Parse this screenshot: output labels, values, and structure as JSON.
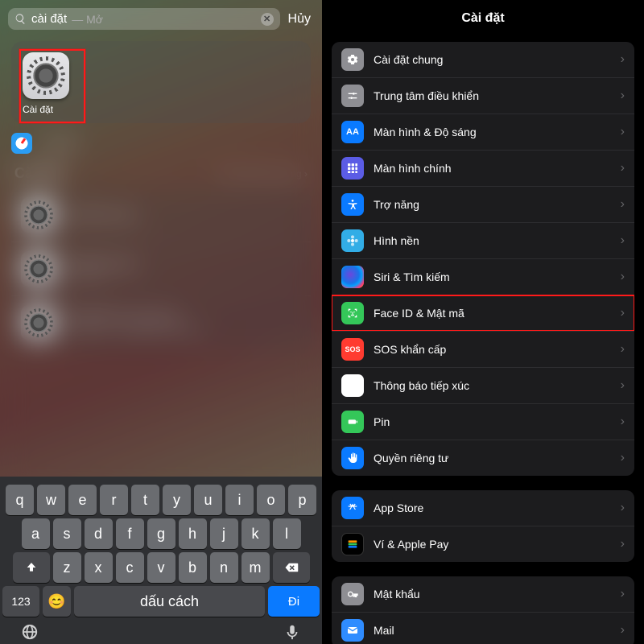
{
  "left": {
    "search": {
      "query": "cài đặt",
      "hint": "— Mở",
      "cancel": "Hủy"
    },
    "top_app": {
      "label": "Cài đặt"
    },
    "suggestion": {
      "text": "cài đặt"
    },
    "section": {
      "title": "Cài đặt",
      "link": "Tìm trong ứng dụng"
    },
    "results": [
      {
        "title": "Cài đặt chung",
        "sub": ""
      },
      {
        "title": "Cài đặt chung",
        "sub": "Trợ năng"
      },
      {
        "title": "Cài đặt theo ứng dụng",
        "sub": "Trợ năng → Cài đặt theo ứng dụng"
      }
    ],
    "keyboard": {
      "r1": [
        "q",
        "w",
        "e",
        "r",
        "t",
        "y",
        "u",
        "i",
        "o",
        "p"
      ],
      "r2": [
        "a",
        "s",
        "d",
        "f",
        "g",
        "h",
        "j",
        "k",
        "l"
      ],
      "r3": [
        "z",
        "x",
        "c",
        "v",
        "b",
        "n",
        "m"
      ],
      "switch": "123",
      "space": "dấu cách",
      "go": "Đi"
    }
  },
  "right": {
    "title": "Cài đặt",
    "g1": [
      {
        "icon": "gear",
        "bg": "bg-grey",
        "label": "Cài đặt chung"
      },
      {
        "icon": "sliders",
        "bg": "bg-grey",
        "label": "Trung tâm điều khiển"
      },
      {
        "icon": "AA",
        "bg": "bg-blue",
        "label": "Màn hình & Độ sáng",
        "text": true
      },
      {
        "icon": "grid",
        "bg": "bg-indigo",
        "label": "Màn hình chính"
      },
      {
        "icon": "access",
        "bg": "bg-blue",
        "label": "Trợ năng"
      },
      {
        "icon": "flower",
        "bg": "bg-cyan",
        "label": "Hình nền"
      },
      {
        "icon": "siri",
        "bg": "siri-grad",
        "label": "Siri & Tìm kiếm"
      },
      {
        "icon": "faceid",
        "bg": "bg-green",
        "label": "Face ID & Mật mã",
        "highlight": true
      },
      {
        "icon": "SOS",
        "bg": "bg-red",
        "label": "SOS khẩn cấp",
        "text": true,
        "small": true
      },
      {
        "icon": "expose",
        "bg": "bg-white",
        "label": "Thông báo tiếp xúc"
      },
      {
        "icon": "battery",
        "bg": "bg-green",
        "label": "Pin"
      },
      {
        "icon": "hand",
        "bg": "bg-hand",
        "label": "Quyền riêng tư"
      }
    ],
    "g2": [
      {
        "icon": "appstore",
        "bg": "bg-blue",
        "label": "App Store"
      },
      {
        "icon": "wallet",
        "bg": "bg-wallet",
        "label": "Ví & Apple Pay"
      }
    ],
    "g3": [
      {
        "icon": "key",
        "bg": "bg-key",
        "label": "Mật khẩu"
      },
      {
        "icon": "mail",
        "bg": "bg-mail",
        "label": "Mail"
      }
    ]
  }
}
